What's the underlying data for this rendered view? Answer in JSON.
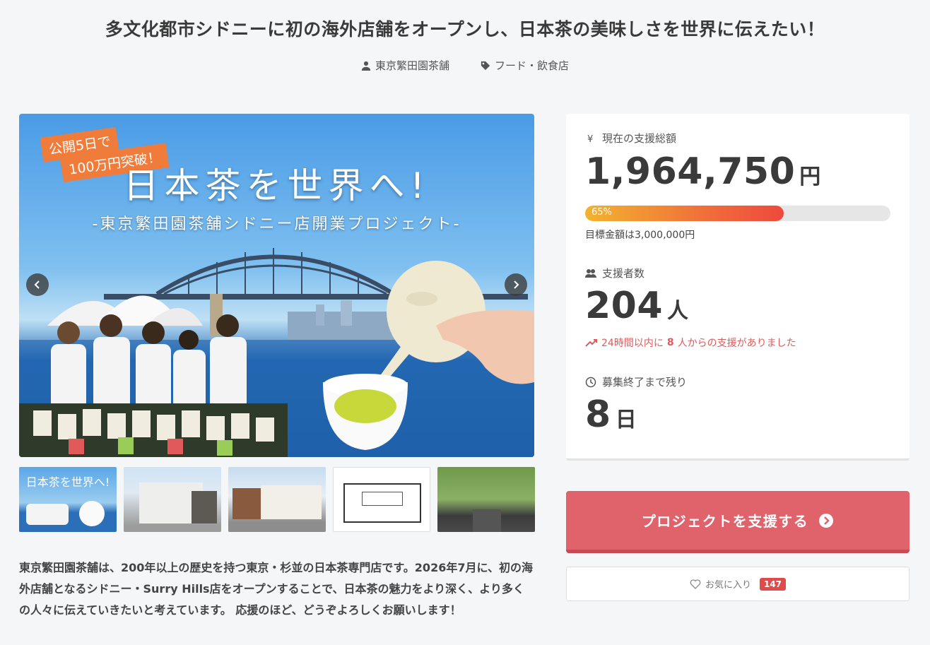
{
  "project": {
    "title": "多文化都市シドニーに初の海外店舗をオープンし、日本茶の美味しさを世界に伝えたい！",
    "owner": "東京繁田園茶舗",
    "category": "フード・飲食店"
  },
  "hero": {
    "badge_line1": "公開5日で",
    "badge_line2": "100万円突破！",
    "headline": "日本茶を世界へ!",
    "subheadline": "-東京繁田園茶舗シドニー店開業プロジェクト-"
  },
  "thumb1": {
    "headline": "日本茶を世界へ!"
  },
  "description": "東京繁田園茶舗は、200年以上の歴史を持つ東京・杉並の日本茶専門店です。2026年7月に、初の海外店舗となるシドニー・Surry Hills店をオープンすることで、日本茶の魅力をより深く、より多くの人々に伝えていきたいと考えています。 応援のほど、どうぞよろしくお願いします！",
  "stats": {
    "total_label": "現在の支援総額",
    "total_amount": "1,964,750",
    "total_unit": "円",
    "progress_percent": 65,
    "progress_text": "65%",
    "goal_text": "目標金額は3,000,000円",
    "supporters_label": "支援者数",
    "supporters_count": "204",
    "supporters_unit": "人",
    "trend_prefix": "24時間以内に",
    "trend_count": "8",
    "trend_suffix": "人からの支援がありました",
    "remaining_label": "募集終了まで残り",
    "remaining_count": "8",
    "remaining_unit": "日"
  },
  "actions": {
    "support_label": "プロジェクトを支援する",
    "favorite_label": "お気に入り",
    "favorite_count": "147"
  },
  "colors": {
    "accent": "#e0626a",
    "progress_start": "#f2b32e",
    "progress_end": "#ee4a3c",
    "trend": "#e05a5a",
    "badge": "#f07c3c"
  },
  "icons": [
    "user-icon",
    "tag-icon",
    "yen-icon",
    "users-icon",
    "trend-up-icon",
    "clock-icon",
    "chevron-left-icon",
    "chevron-right-icon",
    "arrow-circle-right-icon",
    "heart-icon"
  ]
}
